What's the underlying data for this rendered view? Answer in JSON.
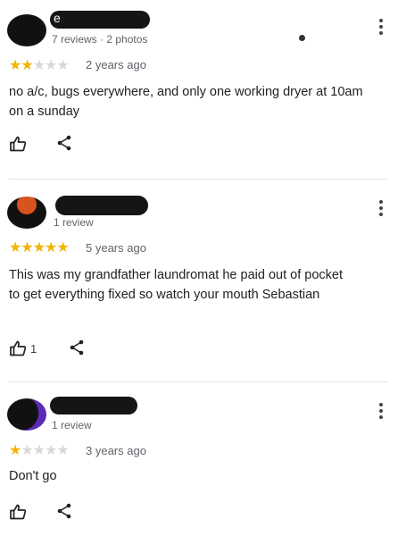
{
  "reviews": [
    {
      "name": "e",
      "meta": "7 reviews · 2 photos",
      "rating": 2,
      "ago": "2 years ago",
      "text": "no a/c, bugs everywhere, and only one working dryer at 10am on a sunday",
      "likes": ""
    },
    {
      "name": "",
      "meta": "1 review",
      "rating": 5,
      "ago": "5 years ago",
      "text": "This was my grandfather laundromat he paid out of pocket to get everything fixed so watch your mouth Sebastian",
      "likes": "1"
    },
    {
      "name": "",
      "meta": "1 review",
      "rating": 1,
      "ago": "3 years ago",
      "text": "Don't go",
      "likes": ""
    }
  ],
  "stars": {
    "on": "★",
    "off": "★"
  },
  "colors": {
    "star": "#f3b400",
    "star_empty": "#d8d8d8",
    "divider": "#e4e4e4"
  },
  "icons": [
    "thumbs-up-icon",
    "share-icon",
    "more-vert-icon"
  ]
}
